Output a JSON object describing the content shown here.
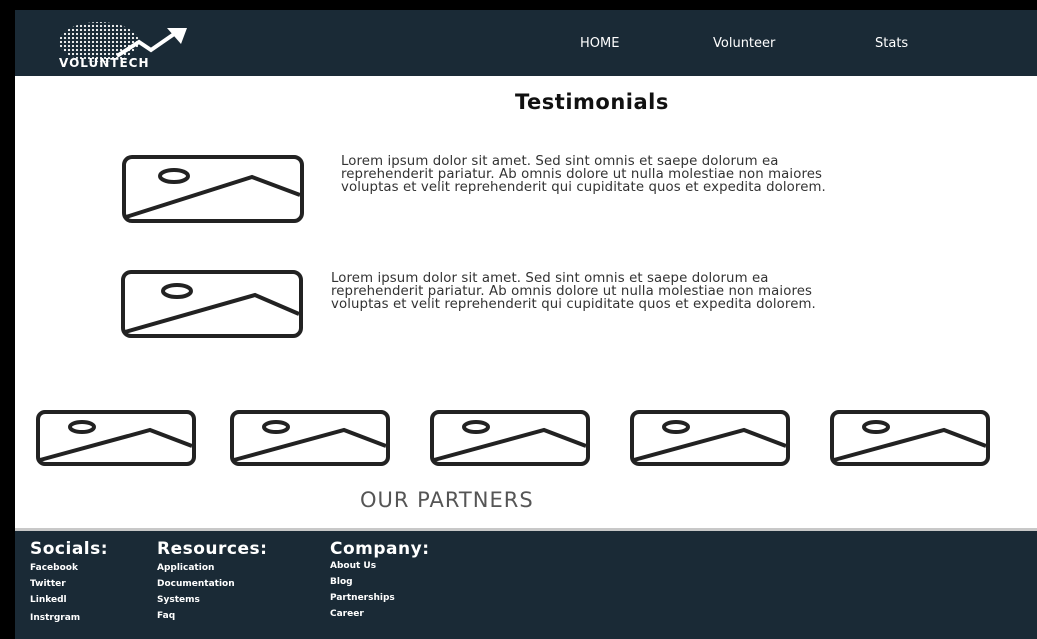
{
  "header": {
    "logo_text": "VOLUNTECH",
    "nav": [
      {
        "label": "HOME"
      },
      {
        "label": "Volunteer"
      },
      {
        "label": "Stats"
      }
    ]
  },
  "main": {
    "title": "Testimonials",
    "testimonials": [
      {
        "text": "Lorem ipsum dolor sit amet. Sed sint omnis et saepe dolorum ea  reprehenderit pariatur. Ab omnis dolore ut nulla molestiae non maiores voluptas et velit reprehenderit qui cupiditate quos et expedita dolorem."
      },
      {
        "text": "Lorem ipsum dolor sit amet. Sed sint omnis et saepe dolorum ea  reprehenderit pariatur. Ab omnis dolore ut nulla molestiae non maiores voluptas et velit reprehenderit qui cupiditate quos et expedita dolorem."
      }
    ],
    "partners_title": "OUR PARTNERS"
  },
  "footer": {
    "columns": [
      {
        "heading": "Socials:",
        "links": [
          "Facebook",
          "Twitter",
          "Linkedl",
          "Instrgram"
        ]
      },
      {
        "heading": "Resources:",
        "links": [
          "Application",
          "Documentation",
          "Systems",
          "Faq"
        ]
      },
      {
        "heading": "Company:",
        "links": [
          "About Us",
          "Blog",
          "Partnerships",
          "Career"
        ]
      }
    ]
  },
  "colors": {
    "header_bg": "#1a2a36",
    "footer_bg": "#1a2a36",
    "icon_stroke": "#222222"
  },
  "icons": {
    "placeholder": "image-placeholder-icon",
    "logo": "globe-arrow-icon"
  }
}
